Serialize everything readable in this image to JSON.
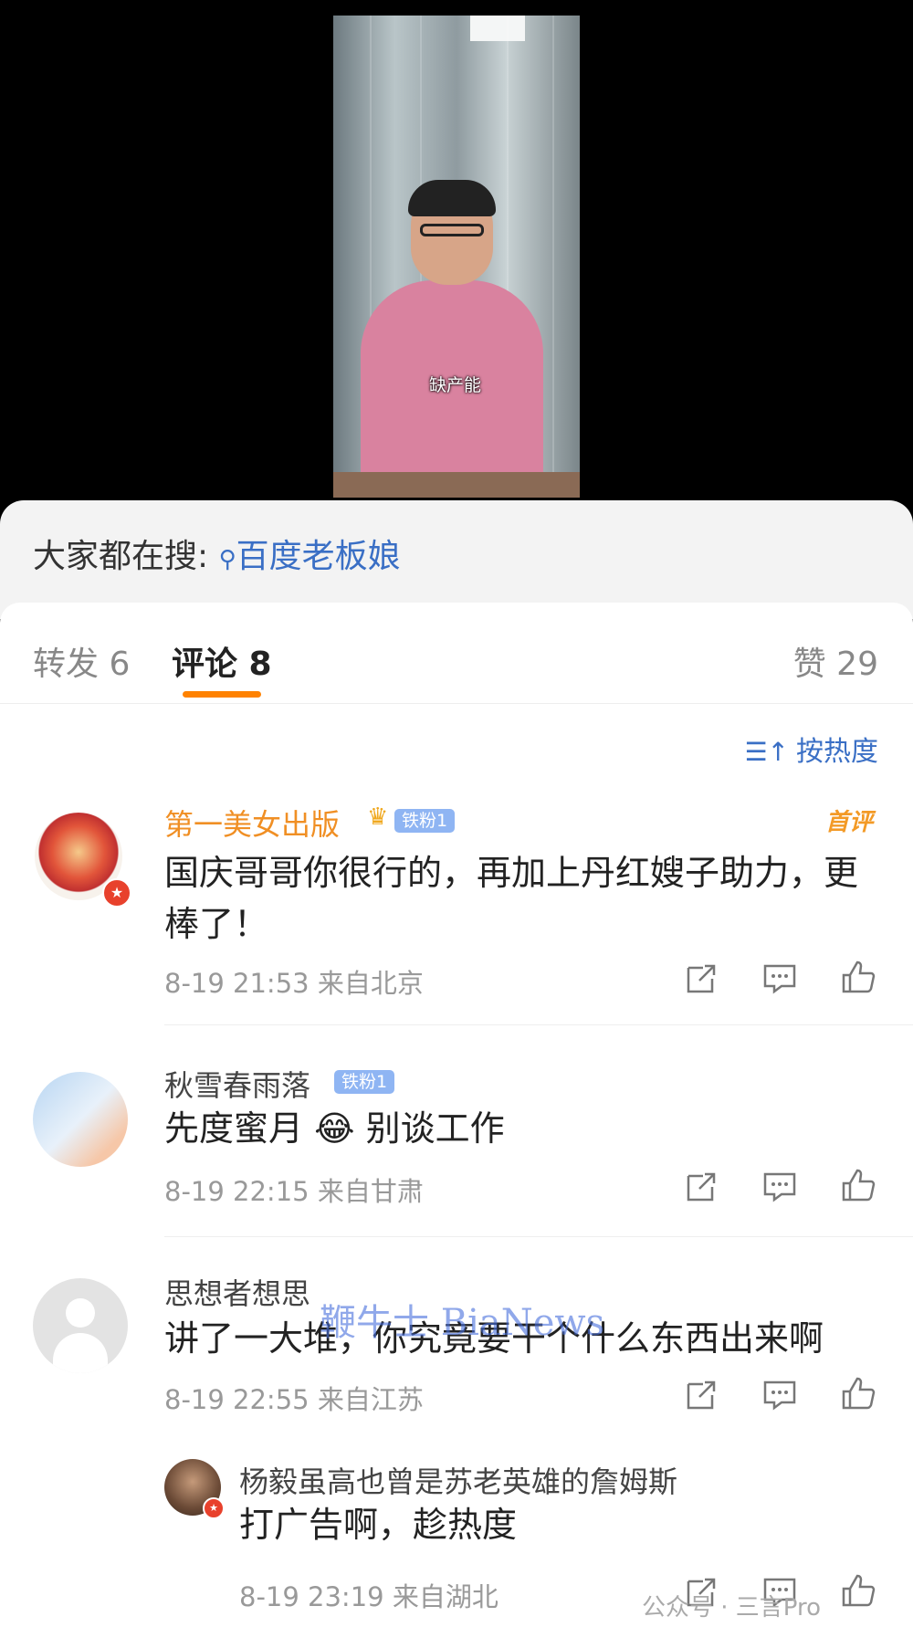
{
  "video": {
    "caption": "缺产能"
  },
  "search": {
    "prefix": "大家都在搜:",
    "query": "百度老板娘"
  },
  "tabs": {
    "repost": "转发 6",
    "comment": "评论 8",
    "like": "赞 29"
  },
  "sort_label": "按热度",
  "comments": [
    {
      "name": "第一美女出版",
      "badge": "铁粉1",
      "first_tag": "首评",
      "text": "国庆哥哥你很行的，再加上丹红嫂子助力，更棒了！",
      "time": "8-19 21:53",
      "location": "来自北京"
    },
    {
      "name": "秋雪春雨落",
      "badge": "铁粉1",
      "text_before": "先度蜜月",
      "emoji": "😂",
      "text_after": "别谈工作",
      "time": "8-19 22:15",
      "location": "来自甘肃"
    },
    {
      "name": "思想者想思",
      "text": "讲了一大堆，你究竟要干个什么东西出来啊",
      "time": "8-19 22:55",
      "location": "来自江苏"
    }
  ],
  "reply": {
    "name": "杨毅虽高也曾是苏老英雄的詹姆斯",
    "text": "打广告啊，趁热度",
    "time": "8-19 23:19",
    "location": "来自湖北"
  },
  "watermark": "鞭牛士 BiaNews",
  "wechat_mark": "公众号 · 三言Pro",
  "colors": {
    "accent_orange": "#ff8200",
    "link_blue": "#3a6fc5",
    "vip_name": "#f08f24"
  }
}
